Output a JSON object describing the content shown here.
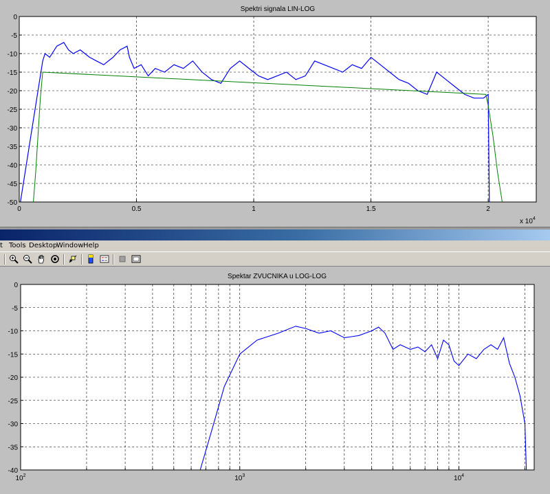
{
  "chart_data": [
    {
      "type": "line",
      "title": "Spektri signala LIN-LOG",
      "xlabel": "",
      "ylabel": "",
      "x_scale": "linear",
      "x_multiplier_label": "x 10",
      "x_multiplier_exponent": "4",
      "xlim": [
        0,
        22050
      ],
      "ylim": [
        -50,
        0
      ],
      "grid": true,
      "x_ticks": [
        0,
        5000,
        10000,
        15000,
        20000
      ],
      "x_tick_labels": [
        "0",
        "0.5",
        "1",
        "1.5",
        "2"
      ],
      "y_ticks": [
        0,
        -5,
        -10,
        -15,
        -20,
        -25,
        -30,
        -35,
        -40,
        -45,
        -50
      ],
      "y_tick_labels": [
        "0",
        "-5",
        "-10",
        "-15",
        "-20",
        "-25",
        "-30",
        "-35",
        "-40",
        "-45",
        "-50"
      ],
      "series": [
        {
          "color": "#0000ff",
          "x": [
            50,
            1000,
            1100,
            1300,
            1600,
            1900,
            2100,
            2300,
            2600,
            3000,
            3300,
            3600,
            4000,
            4300,
            4600,
            4700,
            4900,
            5200,
            5500,
            5800,
            6200,
            6600,
            7000,
            7400,
            7800,
            8200,
            8600,
            9000,
            9400,
            9800,
            10200,
            10600,
            11000,
            11400,
            11800,
            12200,
            12600,
            13000,
            13400,
            13800,
            14200,
            14600,
            15000,
            15400,
            15800,
            16200,
            16600,
            17000,
            17400,
            17800,
            18200,
            18600,
            19000,
            19400,
            19800,
            20000,
            20050
          ],
          "y": [
            -50,
            -12,
            -10,
            -11,
            -8,
            -7,
            -9,
            -10,
            -9,
            -11,
            -12,
            -13,
            -11,
            -9,
            -8,
            -11,
            -14,
            -13,
            -16,
            -14,
            -15,
            -13,
            -14,
            -12,
            -15,
            -17,
            -18,
            -14,
            -12,
            -14,
            -16,
            -17,
            -16,
            -15,
            -17,
            -16,
            -12,
            -13,
            -14,
            -15,
            -13,
            -14,
            -11,
            -13,
            -15,
            -17,
            -18,
            -20,
            -21,
            -15,
            -17,
            -19,
            -21,
            -22,
            -22,
            -21,
            -50
          ]
        },
        {
          "color": "#008000",
          "x": [
            600,
            700,
            800,
            900,
            1000,
            19900,
            20000,
            20200,
            20400,
            20600
          ],
          "y": [
            -50,
            -42,
            -32,
            -22,
            -15,
            -21,
            -24,
            -32,
            -42,
            -50
          ]
        }
      ]
    },
    {
      "type": "line",
      "title": "Spektar ZVUCNIKA u LOG-LOG",
      "xlabel": "",
      "ylabel": "",
      "x_scale": "log",
      "xlim": [
        100,
        22050
      ],
      "ylim": [
        -40,
        0
      ],
      "grid": true,
      "x_tick_labels": [
        {
          "base": "10",
          "exp": "2",
          "value": 100
        },
        {
          "base": "10",
          "exp": "3",
          "value": 1000
        },
        {
          "base": "10",
          "exp": "4",
          "value": 10000
        }
      ],
      "y_ticks": [
        0,
        -5,
        -10,
        -15,
        -20,
        -25,
        -30,
        -35,
        -40
      ],
      "y_tick_labels": [
        "0",
        "-5",
        "-10",
        "-15",
        "-20",
        "-25",
        "-30",
        "-35",
        "-40"
      ],
      "series": [
        {
          "color": "#0000ff",
          "x": [
            660,
            750,
            850,
            1000,
            1200,
            1500,
            1800,
            2000,
            2300,
            2600,
            3000,
            3500,
            4000,
            4300,
            4600,
            5000,
            5400,
            6000,
            6500,
            7000,
            7500,
            8000,
            8500,
            9000,
            9500,
            10000,
            11000,
            12000,
            13000,
            14000,
            15000,
            16000,
            17000,
            18000,
            19000,
            20000,
            20300
          ],
          "y": [
            -40,
            -31,
            -22,
            -15,
            -12,
            -10.5,
            -9,
            -9.5,
            -10.5,
            -10,
            -11.5,
            -11,
            -10,
            -9.2,
            -10.5,
            -14,
            -13,
            -14,
            -13.5,
            -14.5,
            -13,
            -16,
            -12,
            -13,
            -16.5,
            -17.5,
            -15,
            -16,
            -14,
            -13,
            -14,
            -11.5,
            -17,
            -20,
            -24,
            -30,
            -40
          ]
        }
      ]
    }
  ],
  "menu": {
    "items": [
      "t",
      "Tools",
      "Desktop",
      "Window",
      "Help"
    ]
  },
  "toolbar": {
    "icons": [
      "zoom-in-icon",
      "zoom-out-icon",
      "pan-icon",
      "rotate-icon",
      "data-cursor-icon",
      "colorbar-icon",
      "legend-icon",
      "hide-plot-tools-icon",
      "show-plot-tools-icon"
    ]
  },
  "colors": {
    "plot_background": "#ffffff",
    "figure_background": "#c0c0c0",
    "spectrum_line": "#0000ff",
    "envelope_line": "#008000",
    "titlebar_start": "#0a246a",
    "titlebar_end": "#a6caf0"
  }
}
